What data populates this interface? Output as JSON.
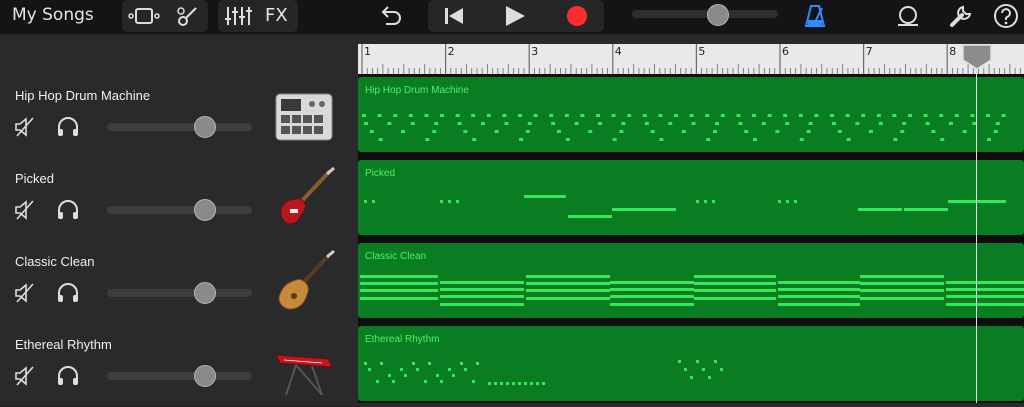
{
  "toolbar": {
    "my_songs": "My Songs",
    "fx": "FX",
    "buttons": [
      "tracks-view-icon",
      "browser-icon",
      "mixer-icon",
      "fx",
      "undo-icon",
      "rewind-icon",
      "play-icon",
      "record-icon",
      "volume-slider",
      "metronome-icon",
      "loop-icon",
      "settings-icon",
      "help-icon"
    ],
    "master_volume": 0.6,
    "record_color": "#ff2d2d",
    "metronome_color": "#2f8cff"
  },
  "ruler": {
    "bars": [
      "1",
      "2",
      "3",
      "4",
      "5",
      "6",
      "7",
      "8"
    ]
  },
  "tracks": [
    {
      "name": "Hip Hop Drum Machine",
      "instrument": "drum-machine",
      "volume": 0.7
    },
    {
      "name": "Picked",
      "instrument": "bass-guitar",
      "volume": 0.7
    },
    {
      "name": "Classic Clean",
      "instrument": "electric-guitar",
      "volume": 0.7
    },
    {
      "name": "Ethereal Rhythm",
      "instrument": "keyboard",
      "volume": 0.7
    }
  ],
  "regions": [
    {
      "label": "Hip Hop Drum Machine"
    },
    {
      "label": "Picked"
    },
    {
      "label": "Classic Clean"
    },
    {
      "label": "Ethereal Rhythm"
    }
  ],
  "colors": {
    "region": "#0a7d22",
    "note": "#35e85a",
    "label": "#4cf06a"
  }
}
